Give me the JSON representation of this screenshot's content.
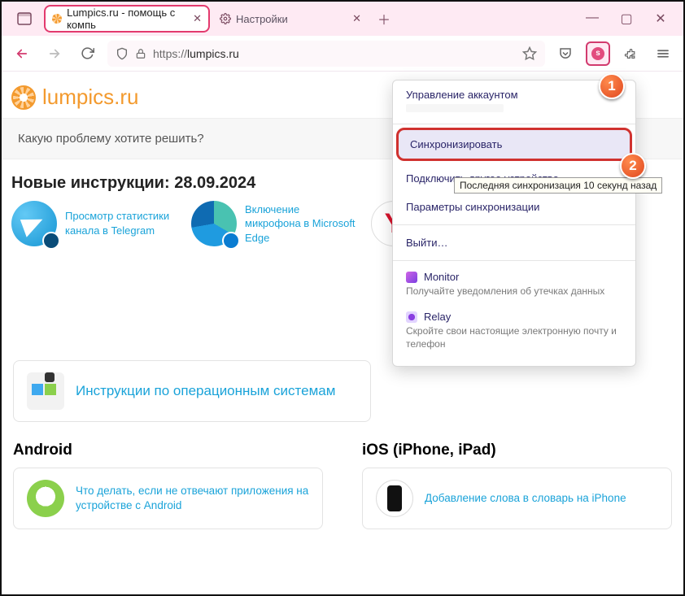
{
  "titlebar": {
    "tabs": [
      {
        "title": "Lumpics.ru - помощь с компь",
        "active": true
      },
      {
        "title": "Настройки",
        "active": false
      }
    ]
  },
  "toolbar": {
    "url_proto": "https://",
    "url_host": "lumpics.ru"
  },
  "brand": "lumpics.ru",
  "search_placeholder": "Какую проблему хотите решить?",
  "new_instructions_heading": "Новые инструкции: 28.09.2024",
  "cards": [
    {
      "text": "Просмотр статистики канала в Telegram"
    },
    {
      "text": "Включение микрофона в Microsoft Edge"
    },
    {
      "text": ""
    }
  ],
  "os_box": "Инструкции по операционным системам",
  "platforms": {
    "android": {
      "heading": "Android",
      "card": "Что делать, если не отвечают приложения на устройстве с Android"
    },
    "ios": {
      "heading": "iOS (iPhone, iPad)",
      "card": "Добавление слова в словарь на iPhone"
    }
  },
  "dropdown": {
    "manage": "Управление аккаунтом",
    "sync": "Синхронизировать",
    "connect": "Подключить другое устройство…",
    "settings": "Параметры синхронизации",
    "signout": "Выйти…",
    "monitor": {
      "title": "Monitor",
      "desc": "Получайте уведомления об утечках данных"
    },
    "relay": {
      "title": "Relay",
      "desc": "Скройте свои настоящие электронную почту и телефон"
    }
  },
  "tooltip": "Последняя синхронизация 10 секунд назад",
  "callouts": {
    "one": "1",
    "two": "2"
  }
}
